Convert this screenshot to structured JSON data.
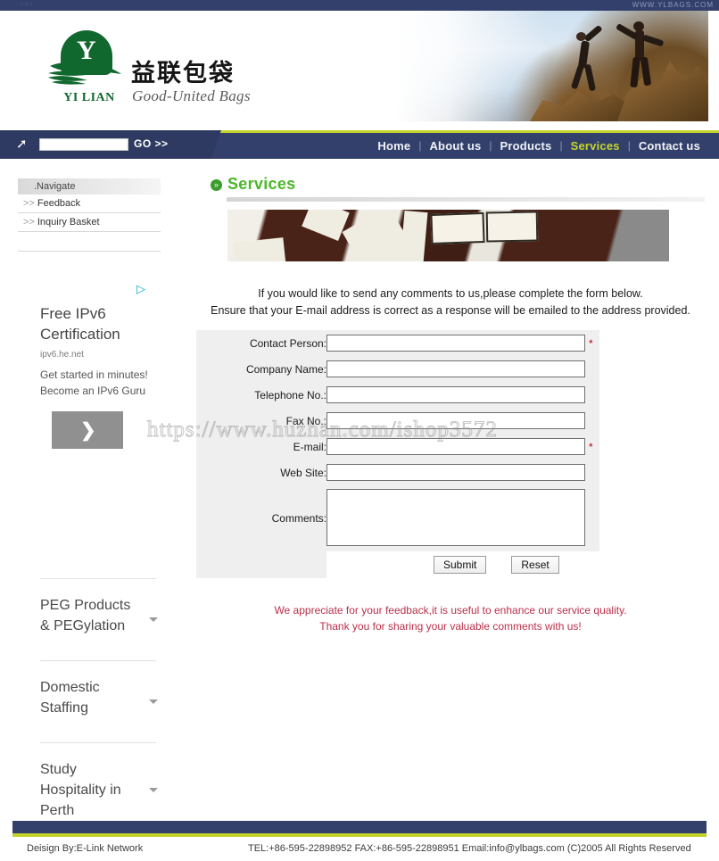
{
  "topbar": {
    "left_tiny": ">>>",
    "right_site": "WWW.YLBAGS.COM"
  },
  "header": {
    "logo_letter": "Y",
    "logo_text": "YI LIAN",
    "brand_cn": "益联包袋",
    "brand_en": "Good-United Bags",
    "plus_row": "+ + + + + + + + + + + + + + + + + + + + + + + + + + + + +"
  },
  "search": {
    "value": "",
    "placeholder": "",
    "go_label": "GO >>"
  },
  "mainnav": {
    "items": [
      {
        "label": "Home",
        "active": false
      },
      {
        "label": "About us",
        "active": false
      },
      {
        "label": "Products",
        "active": false
      },
      {
        "label": "Services",
        "active": true
      },
      {
        "label": "Contact us",
        "active": false
      }
    ],
    "separator": "|"
  },
  "sidebar": {
    "title": ".Navigate",
    "links": [
      {
        "chev": ">>",
        "label": "Feedback"
      },
      {
        "chev": ">>",
        "label": "Inquiry Basket"
      }
    ]
  },
  "ads": {
    "badge": "▷",
    "main": {
      "title": "Free IPv6 Certification",
      "url": "ipv6.he.net",
      "desc": "Get started in minutes! Become an IPv6 Guru",
      "cta": "›"
    },
    "list": [
      {
        "label": "PEG Products & PEGylation"
      },
      {
        "label": "Domestic Staffing"
      },
      {
        "label": "Study Hospitality in Perth"
      }
    ]
  },
  "main": {
    "page_title": "Services",
    "page_icon": "»",
    "intro_line1": "If you would like to send any comments to us,please complete the form below.",
    "intro_line2": "Ensure that your E-mail address is correct as a response will be emailed to the address provided.",
    "fields": [
      {
        "label": "Contact Person:",
        "value": "",
        "required": true,
        "star": "*"
      },
      {
        "label": "Company Name:",
        "value": "",
        "required": false,
        "star": ""
      },
      {
        "label": "Telephone No.:",
        "value": "",
        "required": false,
        "star": ""
      },
      {
        "label": "Fax No.:",
        "value": "",
        "required": false,
        "star": ""
      },
      {
        "label": "E-mail:",
        "value": "",
        "required": true,
        "star": "*"
      },
      {
        "label": "Web Site:",
        "value": "",
        "required": false,
        "star": ""
      }
    ],
    "comments_label": "Comments:",
    "comments_value": "",
    "submit_label": "Submit",
    "reset_label": "Reset",
    "thanks_line1": "We appreciate for your feedback,it is useful to enhance our service quality.",
    "thanks_line2": "Thank you for sharing your valuable comments with us!"
  },
  "footer": {
    "design_by": "Deisign By:E-Link Network",
    "contact": "TEL:+86-595-22898952 FAX:+86-595-22898951 Email:info@ylbags.com (C)2005 All Rights Reserved"
  },
  "watermark": {
    "text": "https://www.huzhan.com/ishop3572"
  },
  "colors": {
    "navy": "#33406b",
    "lime": "#c3d52b",
    "green": "#4cb72a",
    "logo_green": "#11682f",
    "thanks_red": "#b8304a",
    "required_red": "#c00000"
  }
}
